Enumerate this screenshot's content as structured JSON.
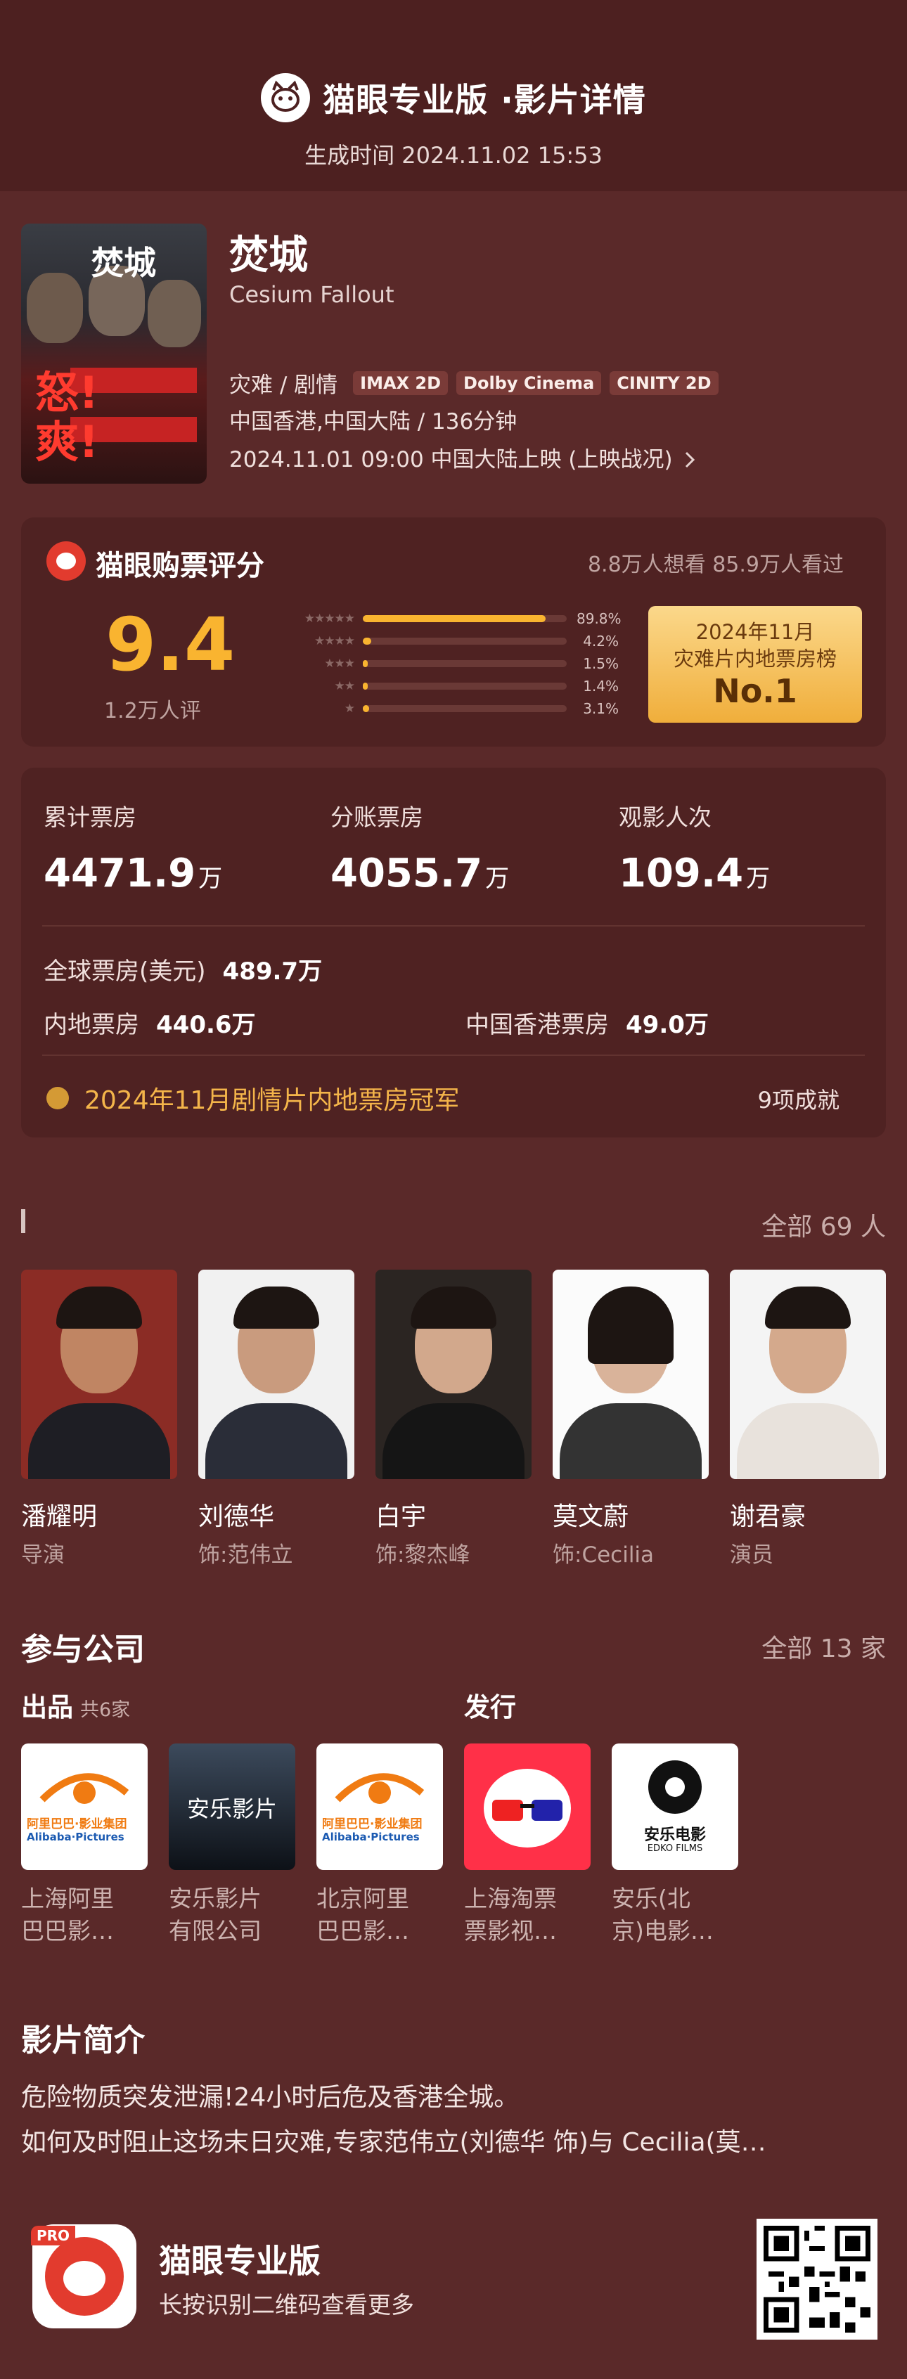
{
  "header": {
    "brand": "猫眼专业版",
    "page_title": "·影片详情",
    "generated": "生成时间 2024.11.02 15:53"
  },
  "movie": {
    "title": "焚城",
    "english_title": "Cesium Fallout",
    "genre": "灾难 / 剧情",
    "formats": [
      "IMAX 2D",
      "Dolby Cinema",
      "CINITY 2D"
    ],
    "region_duration": "中国香港,中国大陆 / 136分钟",
    "release": "2024.11.01 09:00 中国大陆上映 (上映战况)",
    "poster_text": [
      "焚城",
      "怒!",
      "爽!"
    ]
  },
  "rating": {
    "title": "猫眼购票评分",
    "stats": "8.8万人想看  85.9万人看过",
    "score": "9.4",
    "count": "1.2万人评",
    "distribution": [
      {
        "stars": 5,
        "percent": 89.8,
        "label": "89.8%"
      },
      {
        "stars": 4,
        "percent": 4.2,
        "label": "4.2%"
      },
      {
        "stars": 3,
        "percent": 1.5,
        "label": "1.5%"
      },
      {
        "stars": 2,
        "percent": 1.4,
        "label": "1.4%"
      },
      {
        "stars": 1,
        "percent": 3.1,
        "label": "3.1%"
      }
    ],
    "rank_line1": "2024年11月",
    "rank_line2": "灾难片内地票房榜",
    "rank_no": "No.1"
  },
  "boxoffice": {
    "cumulative": {
      "label": "累计票房",
      "value": "4471.9",
      "unit": "万"
    },
    "split": {
      "label": "分账票房",
      "value": "4055.7",
      "unit": "万"
    },
    "admissions": {
      "label": "观影人次",
      "value": "109.4",
      "unit": "万"
    },
    "global_label": "全球票房(美元)",
    "global_value": "489.7万",
    "mainland_label": "内地票房",
    "mainland_value": "440.6万",
    "hk_label": "中国香港票房",
    "hk_value": "49.0万",
    "champion": "2024年11月剧情片内地票房冠军",
    "achievements": "9项成就"
  },
  "cast": {
    "more": "全部 69 人",
    "members": [
      {
        "name": "潘耀明",
        "role": "导演"
      },
      {
        "name": "刘德华",
        "role": "饰:范伟立"
      },
      {
        "name": "白宇",
        "role": "饰:黎杰峰"
      },
      {
        "name": "莫文蔚",
        "role": "饰:Cecilia"
      },
      {
        "name": "谢君豪",
        "role": "演员"
      }
    ]
  },
  "companies": {
    "title": "参与公司",
    "more": "全部 13 家",
    "produce_label": "出品",
    "produce_count": "共6家",
    "distribute_label": "发行",
    "items": [
      {
        "line1": "上海阿里",
        "line2": "巴巴影…",
        "logo_text": "阿里巴巴·影业集团",
        "logo_sub": "Alibaba·Pictures"
      },
      {
        "line1": "安乐影片",
        "line2": "有限公司",
        "logo_text": "安乐影片"
      },
      {
        "line1": "北京阿里",
        "line2": "巴巴影…",
        "logo_text": "阿里巴巴·影业集团",
        "logo_sub": "Alibaba·Pictures"
      },
      {
        "line1": "上海淘票",
        "line2": "票影视…"
      },
      {
        "line1": "安乐(北",
        "line2": "京)电影…",
        "logo_text": "安乐电影",
        "logo_sub": "EDKO FILMS"
      }
    ]
  },
  "synopsis": {
    "title": "影片简介",
    "line1": "危险物质突发泄漏!24小时后危及香港全城。",
    "line2": "如何及时阻止这场末日灾难,专家范伟立(刘德华 饰)与 Cecilia(莫…"
  },
  "footer": {
    "app_name": "猫眼专业版",
    "hint": "长按识别二维码查看更多",
    "pro_badge": "PRO"
  },
  "colors": {
    "background": "#5a2929",
    "card": "#4f2222",
    "accent_gold": "#f9b430",
    "brand_red": "#e23b2e"
  }
}
